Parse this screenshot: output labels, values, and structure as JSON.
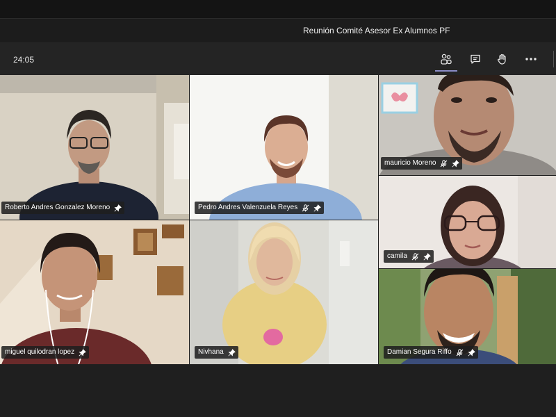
{
  "window": {
    "title": "Reunión Comité Asesor Ex Alumnos PF"
  },
  "toolbar": {
    "timer": "24:05",
    "buttons": [
      {
        "name": "participants-icon"
      },
      {
        "name": "chat-icon"
      },
      {
        "name": "raise-hand-icon"
      },
      {
        "name": "more-options-icon"
      }
    ]
  },
  "participants": [
    {
      "name": "Roberto Andres Gonzalez Moreno",
      "mic": "on",
      "pin": true
    },
    {
      "name": "Pedro Andres Valenzuela Reyes",
      "mic": "muted",
      "pin": true
    },
    {
      "name": "mauricio Moreno",
      "mic": "muted",
      "pin": true
    },
    {
      "name": "camila",
      "mic": "muted",
      "pin": true
    },
    {
      "name": "miguel quilodran lopez",
      "mic": "on",
      "pin": true
    },
    {
      "name": "Nivhana",
      "mic": "on",
      "pin": true
    },
    {
      "name": "Damian Segura Riffo",
      "mic": "muted",
      "pin": true
    }
  ],
  "colors": {
    "background": "#1f1f1f",
    "toolbar": "#242424",
    "accent": "#8b8cc7"
  }
}
